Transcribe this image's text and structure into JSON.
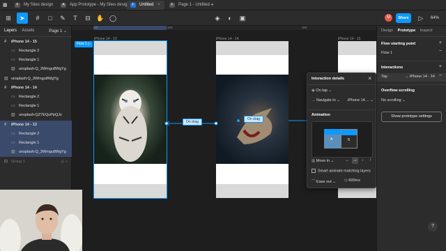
{
  "tabs": [
    {
      "label": "My Sites design",
      "icon": "F"
    },
    {
      "label": "App Prototype - My Sites design",
      "icon": "A"
    },
    {
      "label": "Untitled",
      "icon": "F"
    },
    {
      "label": "Page 1 - Untitled",
      "icon": "F"
    }
  ],
  "toolbar": {
    "share": "Share",
    "zoom": "64%",
    "avatar": "M"
  },
  "left": {
    "tab_layers": "Layers",
    "tab_assets": "Assets",
    "page": "Page 1",
    "layers": [
      {
        "label": "iPhone 14 - 15",
        "kind": "frame"
      },
      {
        "label": "Rectangle 2",
        "kind": "child"
      },
      {
        "label": "Rectangle 1",
        "kind": "child"
      },
      {
        "label": "unsplash:Q_3Wmgu8WgYg",
        "kind": "child"
      },
      {
        "label": "unsplash:Q_3Wmgu8WgYg",
        "kind": "root"
      },
      {
        "label": "iPhone 14 - 14",
        "kind": "frame"
      },
      {
        "label": "Rectangle 2",
        "kind": "child"
      },
      {
        "label": "Rectangle 1",
        "kind": "child"
      },
      {
        "label": "unsplash:QZ7EQuPpQJs",
        "kind": "child"
      },
      {
        "label": "iPhone 14 - 13",
        "kind": "frame"
      },
      {
        "label": "Rectangle 2",
        "kind": "child"
      },
      {
        "label": "Rectangle 1",
        "kind": "child"
      },
      {
        "label": "unsplash:Q_3Wmgu8WgYg",
        "kind": "child"
      },
      {
        "label": "Group 1",
        "kind": "root"
      }
    ]
  },
  "canvas": {
    "ruler_marks": [
      "100",
      "200",
      "300"
    ],
    "frames": [
      "iPhone 14 - 13",
      "iPhone 14 - 14",
      "iPhone 14 - 15"
    ],
    "flow_tag": "Flow 1",
    "connection_label_1": "On drag",
    "connection_label_2": "On drag"
  },
  "popover": {
    "title": "Interaction details",
    "trigger": "On tap",
    "action": "Navigate to",
    "destination": "iPhone 14 ...",
    "animation_title": "Animation",
    "preview_label_a": "A",
    "preview_label_b": "B",
    "transition": "Move in",
    "smart_animate": "Smart animate matching layers",
    "easing": "Ease out",
    "duration": "600ms"
  },
  "right": {
    "tab_design": "Design",
    "tab_prototype": "Prototype",
    "tab_inspect": "Inspect",
    "flow_start_title": "Flow starting point",
    "flow_name": "Flow 1",
    "interactions_title": "Interactions",
    "interaction_trigger": "Tap",
    "interaction_target": "iPhone 14 - 14",
    "overflow_title": "Overflow scrolling",
    "overflow_value": "No scrolling",
    "show_settings": "Show prototype settings"
  },
  "help": "?",
  "colors": {
    "accent": "#0d99ff",
    "panel": "#2c2c2c",
    "canvas": "#1e1e1e"
  }
}
